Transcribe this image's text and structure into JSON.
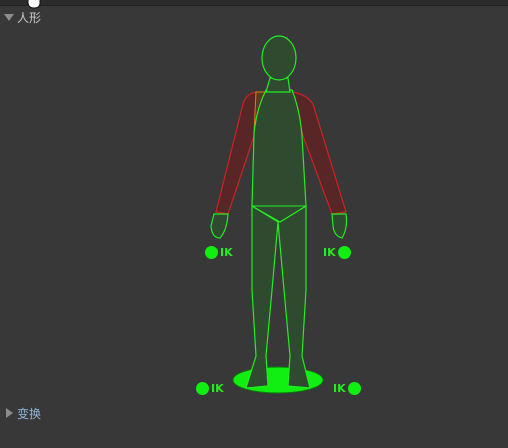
{
  "humanoid_section": {
    "label": "人形",
    "expanded": true
  },
  "transform_section": {
    "label": "变换",
    "expanded": false
  },
  "ik": {
    "left_hand": "IK",
    "right_hand": "IK",
    "left_foot": "IK",
    "right_foot": "IK"
  },
  "colors": {
    "background": "#383838",
    "valid_bone": "#22ee22",
    "invalid_bone": "#cc2222",
    "ik_handle": "#11ee11"
  }
}
